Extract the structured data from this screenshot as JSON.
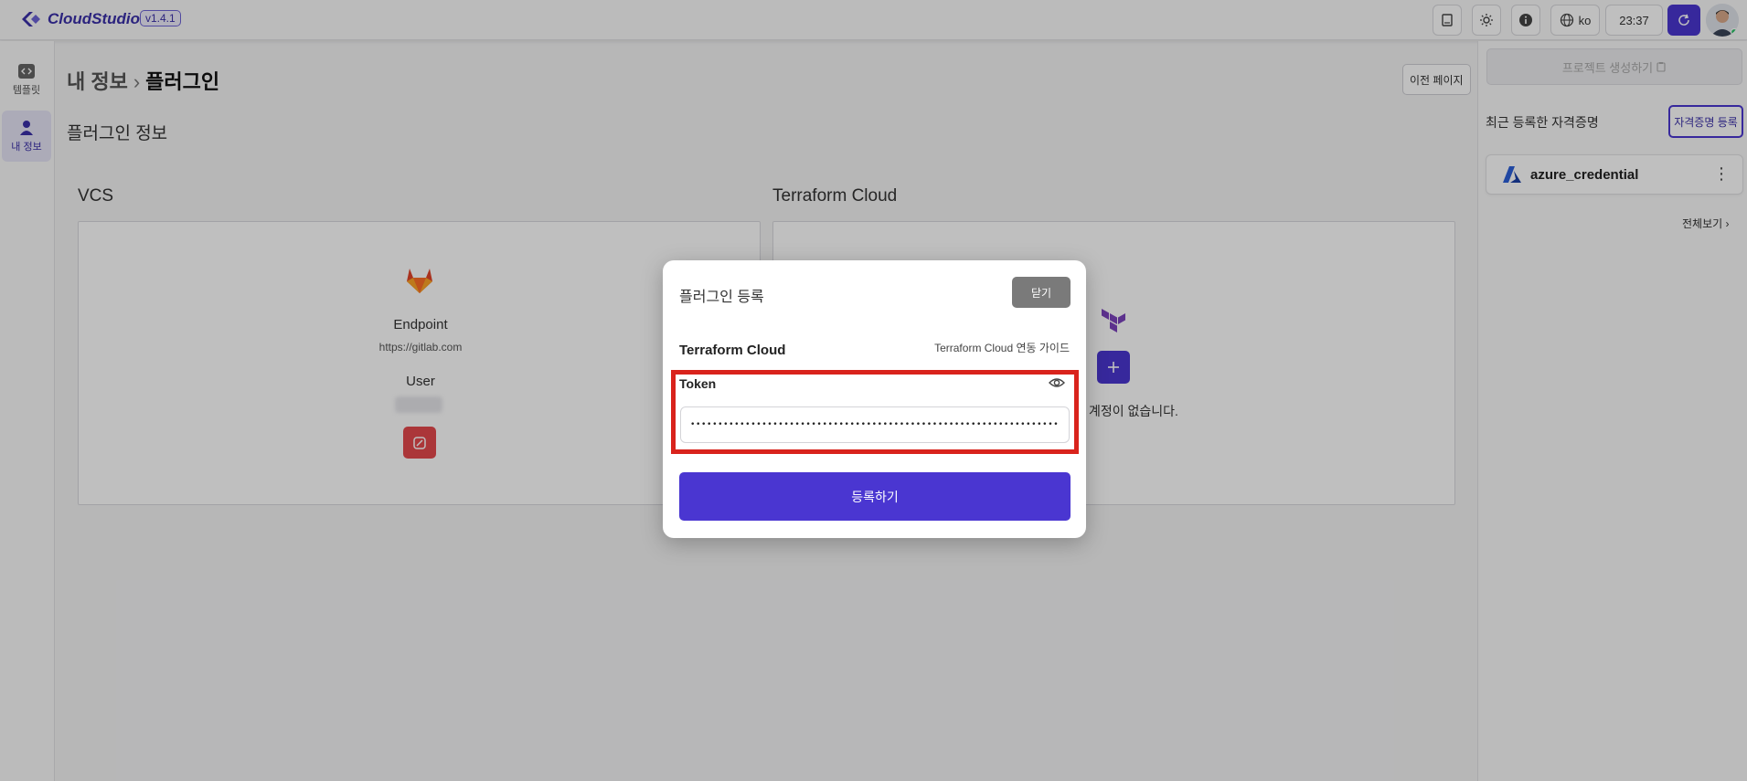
{
  "app": {
    "name": "CloudStudio",
    "version": "v1.4.1"
  },
  "topbar": {
    "lang": "ko",
    "time": "23:37"
  },
  "rail": {
    "items": [
      {
        "label": "템플릿"
      },
      {
        "label": "내 정보"
      }
    ]
  },
  "page": {
    "crumb_parent": "내 정보",
    "crumb_sep": "›",
    "crumb_current": "플러그인",
    "prev_button": "이전 페이지",
    "section_title": "플러그인 정보"
  },
  "vcs": {
    "title": "VCS",
    "endpoint_label": "Endpoint",
    "endpoint_url": "https://gitlab.com",
    "user_label": "User"
  },
  "terraform": {
    "title": "Terraform Cloud",
    "no_account_text": "계정이 없습니다."
  },
  "right_panel": {
    "create_project": "프로젝트 생성하기",
    "recent_title": "최근 등록한 자격증명",
    "register_cred": "자격증명 등록",
    "credentials": [
      {
        "name": "azure_credential"
      }
    ],
    "view_all": "전체보기 ›"
  },
  "modal": {
    "title": "플러그인 등록",
    "close": "닫기",
    "section": "Terraform Cloud",
    "guide": "Terraform Cloud 연동 가이드",
    "token_label": "Token",
    "token_value": "••••••••••••••••••••••••••••••••••••••••••••••••••••••••••••••••••••",
    "submit": "등록하기"
  },
  "colors": {
    "accent": "#4a36d1",
    "highlight": "#d9231c",
    "danger": "#e5484d"
  }
}
